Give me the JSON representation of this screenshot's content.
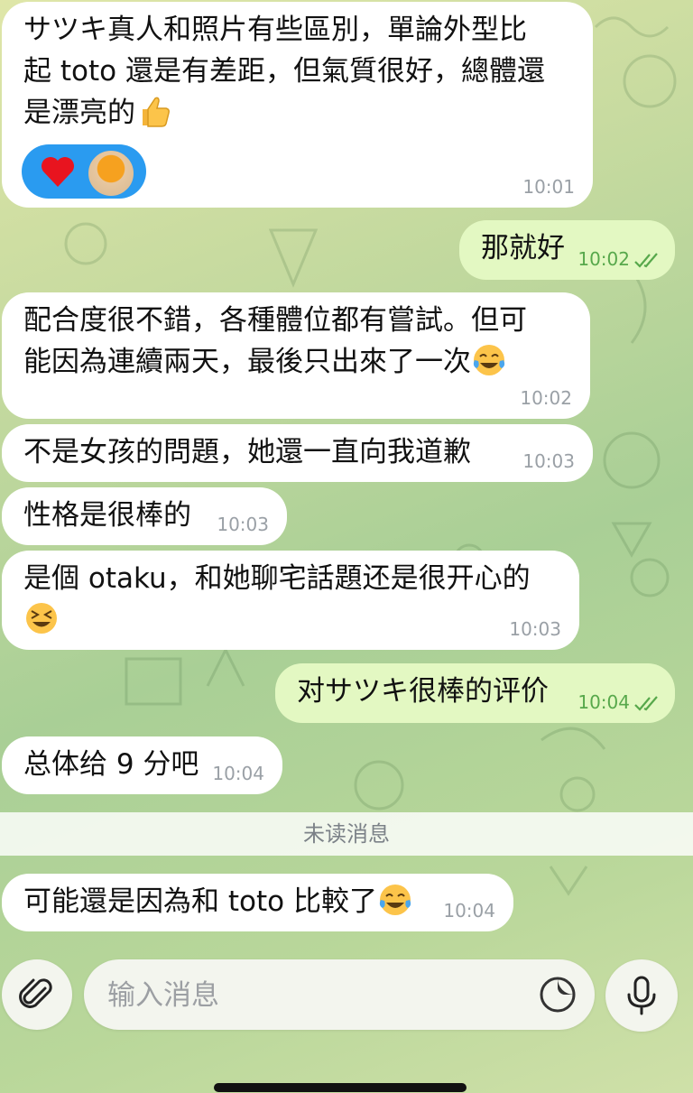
{
  "messages": [
    {
      "text": "サツキ真人和照片有些區別，單論外型比\n起 toto 還是有差距，但氣質很好，總體還\n是漂亮的",
      "emoji": "thumbs-up",
      "time": "10:01"
    },
    {
      "text": "那就好",
      "time": "10:02"
    },
    {
      "text": "配合度很不錯，各種體位都有嘗試。但可\n能因為連續兩天，最後只出來了一次",
      "emoji": "tears-of-joy",
      "time": "10:02"
    },
    {
      "text": "不是女孩的問題，她還一直向我道歉",
      "time": "10:03"
    },
    {
      "text": "性格是很棒的",
      "time": "10:03"
    },
    {
      "text": "是個 otaku，和她聊宅話題还是很开心的",
      "emoji": "laughing-squint",
      "time": "10:03"
    },
    {
      "text": "对サツキ很棒的评价",
      "time": "10:04"
    },
    {
      "text": "总体给 9 分吧",
      "time": "10:04"
    },
    {
      "text": "可能還是因為和 toto 比較了",
      "emoji": "tears-of-joy",
      "time": "10:04"
    }
  ],
  "reactions": {
    "items": [
      "heart-icon",
      "user-avatar"
    ],
    "color": "#2a9bf0"
  },
  "unread_divider": "未读消息",
  "composer": {
    "placeholder": "输入消息",
    "attach_icon": "paperclip-icon",
    "sticker_icon": "sticker-icon",
    "mic_icon": "microphone-icon"
  },
  "colors": {
    "incoming": "#ffffff",
    "outgoing": "#e3f8c2",
    "read_check": "#57a84b"
  }
}
